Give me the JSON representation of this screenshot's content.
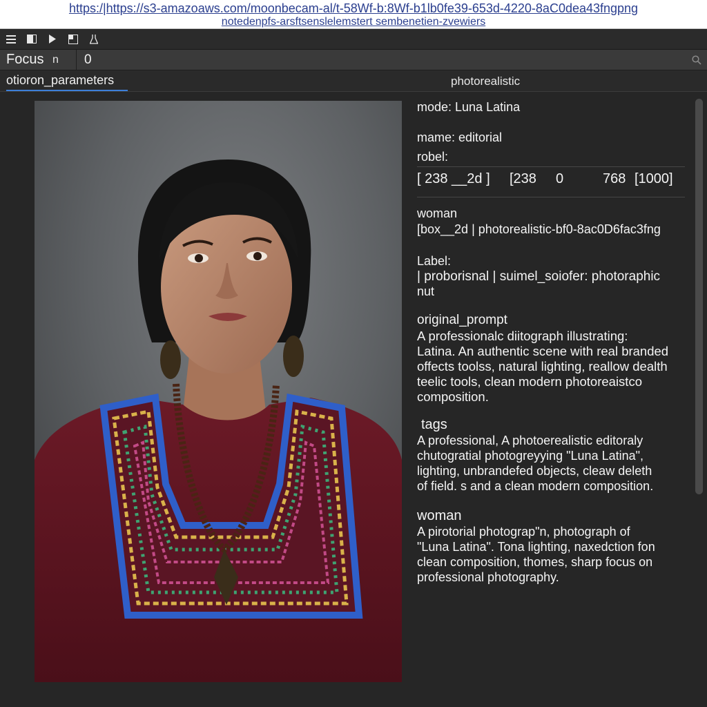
{
  "url": {
    "line1": "https:/|https://s3-amazoaws.com/moonbecam-al/t-58Wf-b:8Wf-b1lb0fe39-653d-4220-8aC0dea43fngpng",
    "line2": "notedenpfs-arsftsenslelemstert sembenetien-zvewiers"
  },
  "toolbar": {
    "icons": [
      "menu-icon",
      "panel-icon",
      "play-icon",
      "split-view-icon",
      "flask-icon"
    ]
  },
  "focus": {
    "label": "Focus",
    "n_label": "n",
    "value": "0"
  },
  "tabs": {
    "active_label": "otioron_parameters",
    "title": "photorealistic"
  },
  "photo": {
    "icon": "portrait-photo"
  },
  "info": {
    "mode": "mode: Luna Latina",
    "name": "mame: editorial",
    "robel": "robel:",
    "bbox_row": [
      "[ 238 __2d ]",
      "[238",
      "0",
      "768",
      "[1000]"
    ],
    "woman_heading": "woman",
    "woman_box": "[box__2d | photorealistic-bf0-8ac0D6fac3fng",
    "label_heading": "Label:",
    "label_value_line1": "| proborisnal | suimel_soiofer: photoraphic",
    "label_value_line2": "nut",
    "original_prompt_heading": "original_prompt",
    "original_prompt_lines": [
      "A professionalc diitograph illustrating:",
      "Latina. An authentic scene with real branded",
      "offects toolss, natural lighting, reallow dealth",
      "teelic tools, clean modern photoreaistco",
      "composition."
    ],
    "tags_heading": "tags",
    "tags_lines": [
      "A professional, A photoerealistic editoraly",
      "chutogratial photogreyying \"Luna Latina\",",
      "lighting, unbrandefed objects, cleaw deleth",
      "of field. s and a clean modern composition."
    ],
    "woman2_heading": "woman",
    "woman2_lines": [
      "A pirotorial photograp\"n, photograph  of",
      "\"Luna Latina\". Tona lighting, naxedction fon",
      "clean composition, thomes, sharp focus on",
      "professional photography."
    ]
  },
  "colors": {
    "background": "#262626",
    "tab_underline": "#3d7fd9",
    "url_text": "#2b3f8f",
    "text": "#f4f4f4"
  }
}
